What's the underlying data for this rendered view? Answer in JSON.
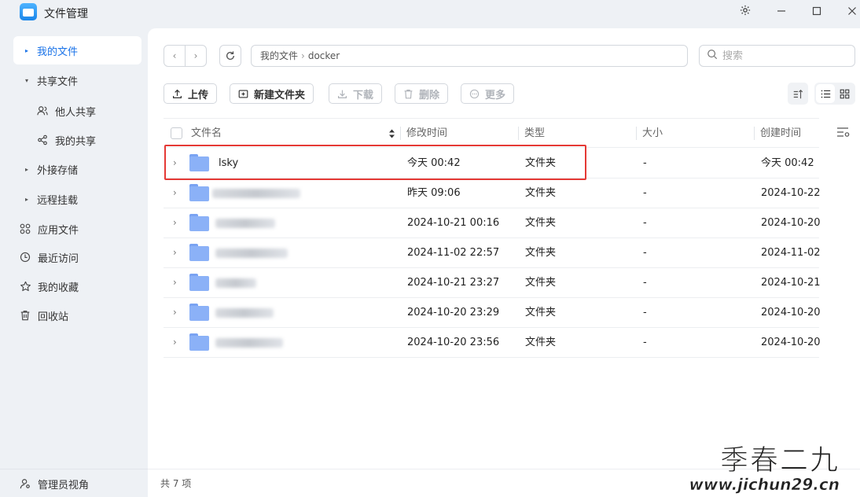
{
  "app": {
    "title": "文件管理"
  },
  "titlebar": {
    "settings_icon": "gear-icon",
    "minimize_icon": "minimize-icon",
    "maximize_icon": "maximize-icon",
    "close_icon": "close-icon"
  },
  "sidebar": {
    "items": [
      {
        "label": "我的文件",
        "icon": "caret-right-icon",
        "active": true
      },
      {
        "label": "共享文件",
        "icon": "caret-down-icon"
      },
      {
        "label": "他人共享",
        "icon": "people-icon"
      },
      {
        "label": "我的共享",
        "icon": "share-icon"
      },
      {
        "label": "外接存储",
        "icon": "caret-right-icon"
      },
      {
        "label": "远程挂载",
        "icon": "caret-right-icon"
      },
      {
        "label": "应用文件",
        "icon": "apps-icon"
      },
      {
        "label": "最近访问",
        "icon": "clock-icon"
      },
      {
        "label": "我的收藏",
        "icon": "star-icon"
      },
      {
        "label": "回收站",
        "icon": "trash-icon"
      }
    ],
    "footer_label": "管理员视角"
  },
  "pathbar": {
    "segments": [
      "我的文件",
      "docker"
    ]
  },
  "search": {
    "placeholder": "搜索"
  },
  "toolbar": {
    "upload_label": "上传",
    "new_folder_label": "新建文件夹",
    "download_label": "下载",
    "delete_label": "删除",
    "more_label": "更多"
  },
  "table": {
    "columns": [
      "文件名",
      "修改时间",
      "类型",
      "大小",
      "创建时间"
    ],
    "rows": [
      {
        "name": "lsky",
        "modified": "今天 00:42",
        "type": "文件夹",
        "size": "-",
        "created": "今天 00:42"
      },
      {
        "name": "",
        "modified": "昨天 09:06",
        "type": "文件夹",
        "size": "-",
        "created": "2024-10-22"
      },
      {
        "name": "",
        "modified": "2024-10-21 00:16",
        "type": "文件夹",
        "size": "-",
        "created": "2024-10-20"
      },
      {
        "name": "",
        "modified": "2024-11-02 22:57",
        "type": "文件夹",
        "size": "-",
        "created": "2024-11-02"
      },
      {
        "name": "",
        "modified": "2024-10-21 23:27",
        "type": "文件夹",
        "size": "-",
        "created": "2024-10-21"
      },
      {
        "name": "",
        "modified": "2024-10-20 23:29",
        "type": "文件夹",
        "size": "-",
        "created": "2024-10-20"
      },
      {
        "name": "",
        "modified": "2024-10-20 23:56",
        "type": "文件夹",
        "size": "-",
        "created": "2024-10-20"
      }
    ]
  },
  "status": {
    "count_text": "共 7 项"
  },
  "watermark": {
    "line1": "季春二九",
    "line2": "www.jichun29.cn"
  },
  "colors": {
    "accent": "#1a73e8",
    "highlight": "#e53935",
    "folder": "#8bb1f7"
  }
}
